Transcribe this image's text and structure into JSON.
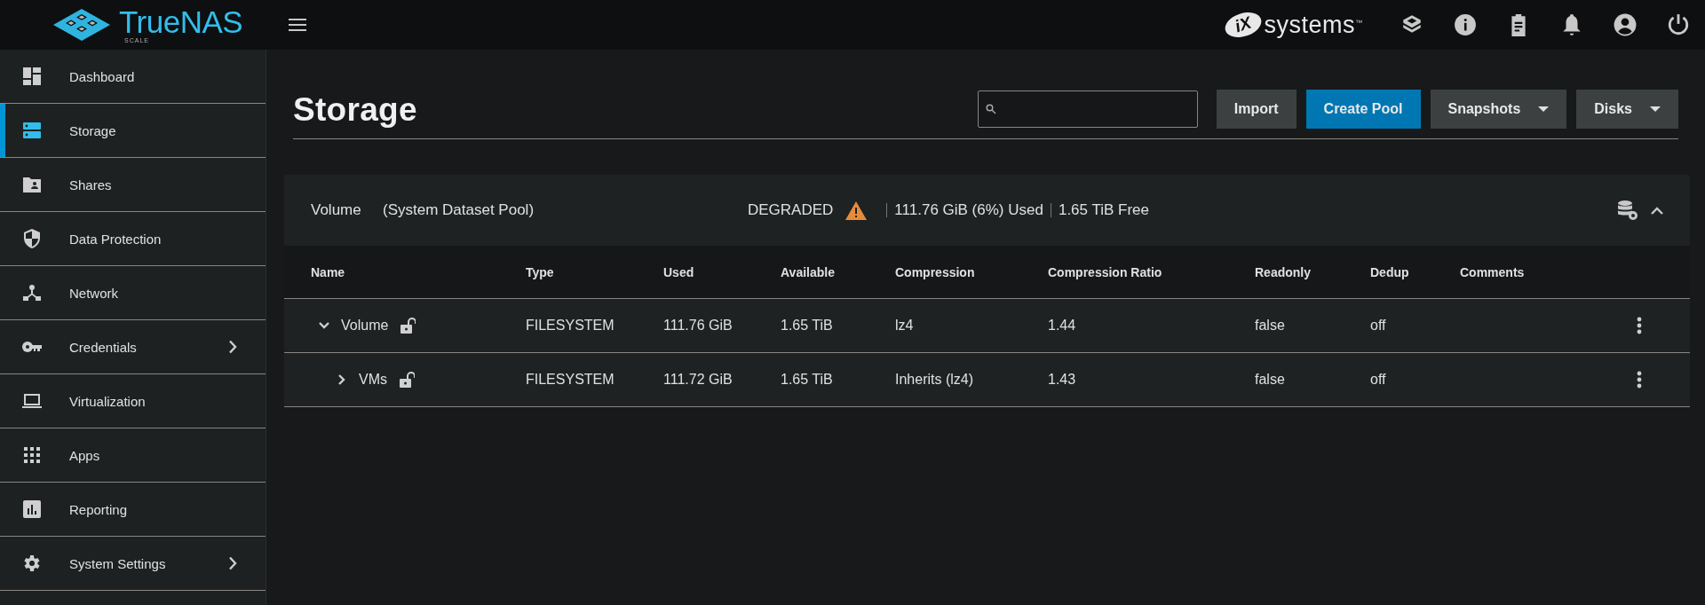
{
  "topbar": {
    "logo_text": "TrueNAS",
    "logo_subtext": "SCALE",
    "brand_mark": "iX",
    "brand_name": "systems",
    "brand_tm": "™"
  },
  "sidebar": {
    "items": [
      {
        "label": "Dashboard",
        "selected": false,
        "submenu": false
      },
      {
        "label": "Storage",
        "selected": true,
        "submenu": false
      },
      {
        "label": "Shares",
        "selected": false,
        "submenu": false
      },
      {
        "label": "Data Protection",
        "selected": false,
        "submenu": false
      },
      {
        "label": "Network",
        "selected": false,
        "submenu": false
      },
      {
        "label": "Credentials",
        "selected": false,
        "submenu": true
      },
      {
        "label": "Virtualization",
        "selected": false,
        "submenu": false
      },
      {
        "label": "Apps",
        "selected": false,
        "submenu": false
      },
      {
        "label": "Reporting",
        "selected": false,
        "submenu": false
      },
      {
        "label": "System Settings",
        "selected": false,
        "submenu": true
      }
    ]
  },
  "page": {
    "title": "Storage",
    "buttons": [
      {
        "label": "Import",
        "kind": "plain",
        "dropdown": false
      },
      {
        "label": "Create Pool",
        "kind": "primary",
        "dropdown": false
      },
      {
        "label": "Snapshots",
        "kind": "plain",
        "dropdown": true
      },
      {
        "label": "Disks",
        "kind": "plain",
        "dropdown": true
      }
    ]
  },
  "pool": {
    "name": "Volume",
    "note": "(System Dataset Pool)",
    "status": "DEGRADED",
    "warning": true,
    "used": "111.76 GiB (6%) Used",
    "free": "1.65 TiB Free",
    "expanded": true,
    "table": {
      "columns": [
        "Name",
        "Type",
        "Used",
        "Available",
        "Compression",
        "Compression Ratio",
        "Readonly",
        "Dedup",
        "Comments"
      ],
      "rows": [
        {
          "locked": false,
          "expanded": true,
          "cells": [
            "Volume",
            "FILESYSTEM",
            "111.76 GiB",
            "1.65 TiB",
            "lz4",
            "1.44",
            "false",
            "off"
          ],
          "children": [
            {
              "locked": false,
              "expanded": false,
              "cells": [
                "VMs",
                "FILESYSTEM",
                "111.72 GiB",
                "1.65 TiB",
                "Inherits (lz4)",
                "1.43",
                "false",
                "off"
              ]
            }
          ]
        }
      ]
    }
  }
}
